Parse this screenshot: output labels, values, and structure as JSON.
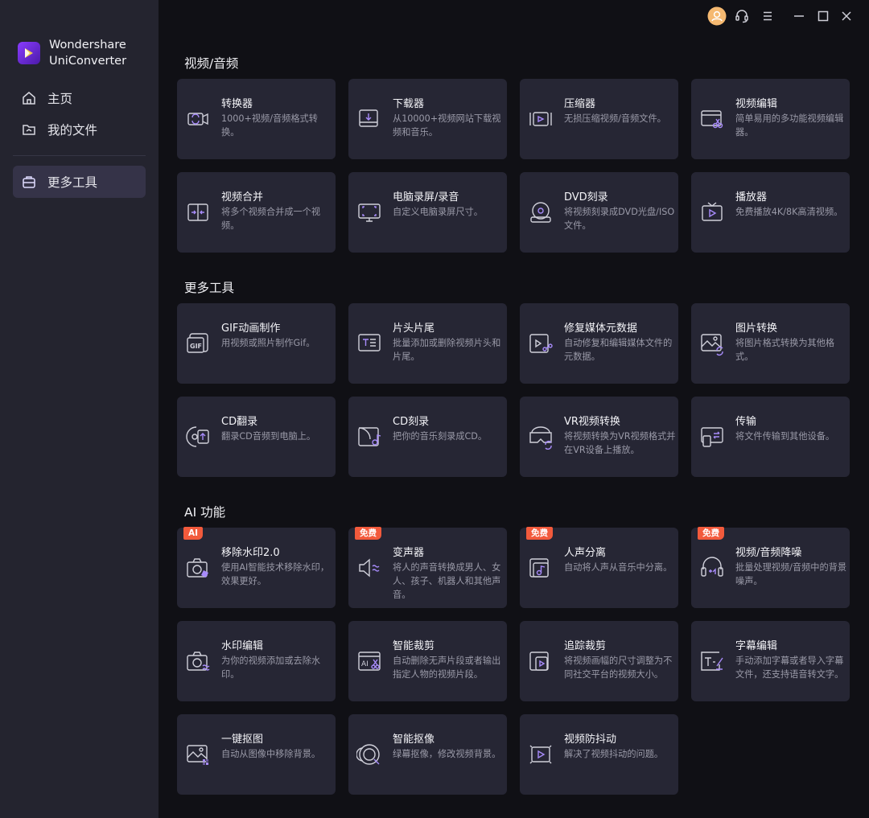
{
  "app": {
    "name_line1": "Wondershare",
    "name_line2": "UniConverter"
  },
  "nav": {
    "home": "主页",
    "files": "我的文件",
    "tools": "更多工具"
  },
  "colors": {
    "accent": "#8a3cff",
    "badge": "#f25a3c",
    "card": "#262634",
    "sidebar": "#24242f"
  },
  "sections": {
    "video_audio": {
      "title": "视频/音频",
      "cards": [
        {
          "title": "转换器",
          "desc": "1000+视频/音频格式转换。",
          "icon": "converter-icon"
        },
        {
          "title": "下载器",
          "desc": "从10000+视频网站下载视频和音乐。",
          "icon": "downloader-icon"
        },
        {
          "title": "压缩器",
          "desc": "无损压缩视频/音频文件。",
          "icon": "compressor-icon"
        },
        {
          "title": "视频编辑",
          "desc": "简单易用的多功能视频编辑器。",
          "icon": "video-editor-icon"
        },
        {
          "title": "视频合并",
          "desc": "将多个视频合并成一个视频。",
          "icon": "merger-icon"
        },
        {
          "title": "电脑录屏/录音",
          "desc": "自定义电脑录屏尺寸。",
          "icon": "screen-recorder-icon"
        },
        {
          "title": "DVD刻录",
          "desc": "将视频刻录成DVD光盘/ISO文件。",
          "icon": "dvd-burner-icon"
        },
        {
          "title": "播放器",
          "desc": "免费播放4K/8K高清视频。",
          "icon": "player-icon"
        }
      ]
    },
    "more_tools": {
      "title": "更多工具",
      "cards": [
        {
          "title": "GIF动画制作",
          "desc": "用视频或照片制作Gif。",
          "icon": "gif-maker-icon"
        },
        {
          "title": "片头片尾",
          "desc": "批量添加或删除视频片头和片尾。",
          "icon": "intro-outro-icon"
        },
        {
          "title": "修复媒体元数据",
          "desc": "自动修复和编辑媒体文件的元数据。",
          "icon": "metadata-icon"
        },
        {
          "title": "图片转换",
          "desc": "将图片格式转换为其他格式。",
          "icon": "image-converter-icon"
        },
        {
          "title": "CD翻录",
          "desc": "翻录CD音频到电脑上。",
          "icon": "cd-ripper-icon"
        },
        {
          "title": "CD刻录",
          "desc": "把你的音乐刻录成CD。",
          "icon": "cd-burner-icon"
        },
        {
          "title": "VR视频转换",
          "desc": "将视频转换为VR视频格式并在VR设备上播放。",
          "icon": "vr-converter-icon"
        },
        {
          "title": "传输",
          "desc": "将文件传输到其他设备。",
          "icon": "transfer-icon"
        }
      ]
    },
    "ai": {
      "title": "AI 功能",
      "cards": [
        {
          "title": "移除水印2.0",
          "desc": "使用AI智能技术移除水印，效果更好。",
          "icon": "watermark-remover-icon",
          "badge": "AI"
        },
        {
          "title": "变声器",
          "desc": "将人的声音转换成男人、女人、孩子、机器人和其他声音。",
          "icon": "voice-changer-icon",
          "badge": "免费"
        },
        {
          "title": "人声分离",
          "desc": "自动将人声从音乐中分离。",
          "icon": "vocal-remover-icon",
          "badge": "免费"
        },
        {
          "title": "视频/音频降噪",
          "desc": "批量处理视频/音频中的背景噪声。",
          "icon": "noise-remover-icon",
          "badge": "免费"
        },
        {
          "title": "水印编辑",
          "desc": "为你的视频添加或去除水印。",
          "icon": "watermark-editor-icon"
        },
        {
          "title": "智能裁剪",
          "desc": "自动删除无声片段或者输出指定人物的视频片段。",
          "icon": "smart-trimmer-icon"
        },
        {
          "title": "追踪裁剪",
          "desc": "将视频画幅的尺寸调整为不同社交平台的视频大小。",
          "icon": "auto-reframe-icon"
        },
        {
          "title": "字幕编辑",
          "desc": "手动添加字幕或者导入字幕文件，还支持语音转文字。",
          "icon": "subtitle-editor-icon"
        },
        {
          "title": "一键抠图",
          "desc": "自动从图像中移除背景。",
          "icon": "bg-remover-icon"
        },
        {
          "title": "智能抠像",
          "desc": "绿幕抠像，修改视频背景。",
          "icon": "smart-cutout-icon"
        },
        {
          "title": "视频防抖动",
          "desc": "解决了视频抖动的问题。",
          "icon": "stabilizer-icon"
        }
      ]
    }
  }
}
